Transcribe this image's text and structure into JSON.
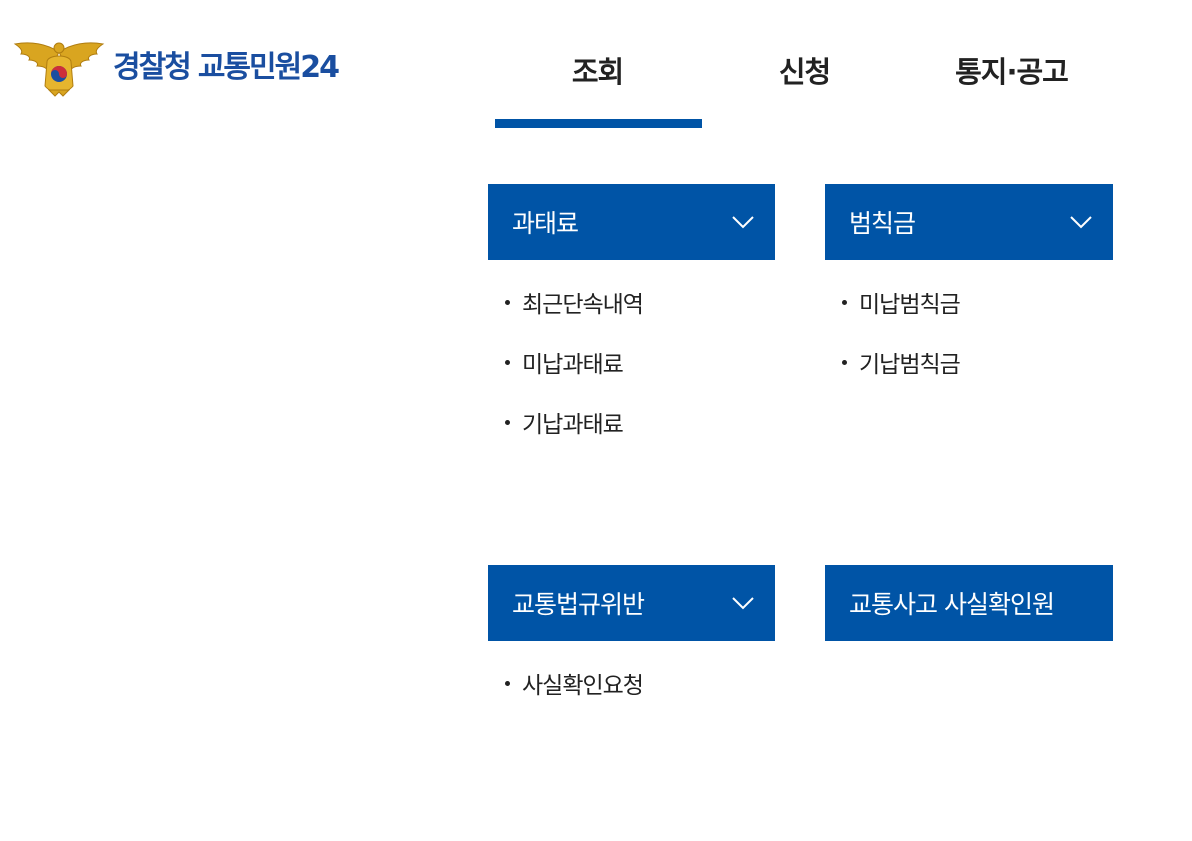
{
  "logo": {
    "agency": "경찰청",
    "service": "교통민원24"
  },
  "nav": {
    "tabs": [
      {
        "label": "조회",
        "active": true
      },
      {
        "label": "신청",
        "active": false
      },
      {
        "label": "통지·공고",
        "active": false
      }
    ]
  },
  "menus": [
    {
      "title": "과태료",
      "expandable": true,
      "items": [
        "최근단속내역",
        "미납과태료",
        "기납과태료"
      ]
    },
    {
      "title": "범칙금",
      "expandable": true,
      "items": [
        "미납범칙금",
        "기납범칙금"
      ]
    },
    {
      "title": "교통법규위반",
      "expandable": true,
      "items": [
        "사실확인요청"
      ]
    },
    {
      "title": "교통사고 사실확인원",
      "expandable": false,
      "items": []
    }
  ],
  "colors": {
    "brand_blue": "#0054a6",
    "logo_text": "#1a4ea0",
    "emblem_gold": "#d9a520",
    "text": "#222222"
  }
}
